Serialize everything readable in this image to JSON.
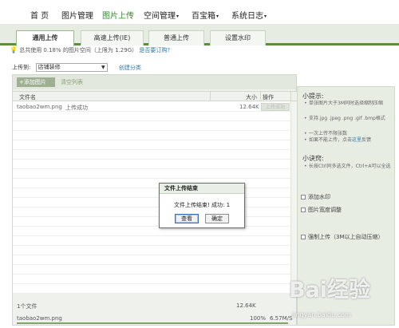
{
  "topnav": {
    "items": [
      {
        "label": "首 页"
      },
      {
        "label": "图片管理"
      },
      {
        "label": "图片上传"
      },
      {
        "label": "空间管理"
      },
      {
        "label": "百宝箱"
      },
      {
        "label": "系统日志"
      }
    ],
    "caret": "▾"
  },
  "tabs": [
    {
      "label": "通用上传"
    },
    {
      "label": "高速上传(IE)"
    },
    {
      "label": "普通上传"
    },
    {
      "label": "设置水印"
    }
  ],
  "quota": {
    "text": "总共使用 0.18% 的图片空间（上限为 1.29G）",
    "link": "是否要订购?"
  },
  "destination": {
    "label": "上传到:",
    "selected": "店铺装修",
    "new_category": "创建分类"
  },
  "toolbar": {
    "add_label": "添加图片",
    "clear_label": "清空列表"
  },
  "grid": {
    "col_name": "文件名",
    "col_size": "大小",
    "col_op": "操作",
    "files": [
      {
        "name": "taobao2wm.png",
        "status": "上传成功",
        "size": "12.64K",
        "op": "上传成功"
      }
    ]
  },
  "summary": {
    "count": "1个文件",
    "total": "12.64K"
  },
  "progress": {
    "filename": "taobao2wm.png",
    "percent": "100%",
    "speed": "6.57M/S",
    "fraction": 1.0
  },
  "side": {
    "tips_title": "小提示:",
    "tips": [
      "单张图片大于3M同时选择缩制压缩",
      "支持.jpg .jpeg .png .gif .bmp格式",
      "一次上传不限张数",
      "如果不能上传，点击"
    ],
    "tip_link": "这里",
    "tip_suffix": "反馈",
    "tricks_title": "小诀窍:",
    "tricks": [
      "长按Ctrl同多选文件，Ctrl+A可以全选"
    ],
    "options": [
      {
        "label": "添加水印"
      },
      {
        "label": "图片宽度调整"
      },
      {
        "label": "强制上传（3M以上自动压缩）"
      }
    ]
  },
  "dialog": {
    "title": "文件上传结束",
    "message": "文件上传结束! 成功: 1",
    "view_label": "查看",
    "ok_label": "确定"
  },
  "watermark": {
    "brand": "Bai经验",
    "url": "jingyan.baidu.com"
  },
  "colors": {
    "accent_green": "#5b8f3e",
    "link_blue": "#2a7ab0",
    "active_nav": "#2a8a2a"
  }
}
